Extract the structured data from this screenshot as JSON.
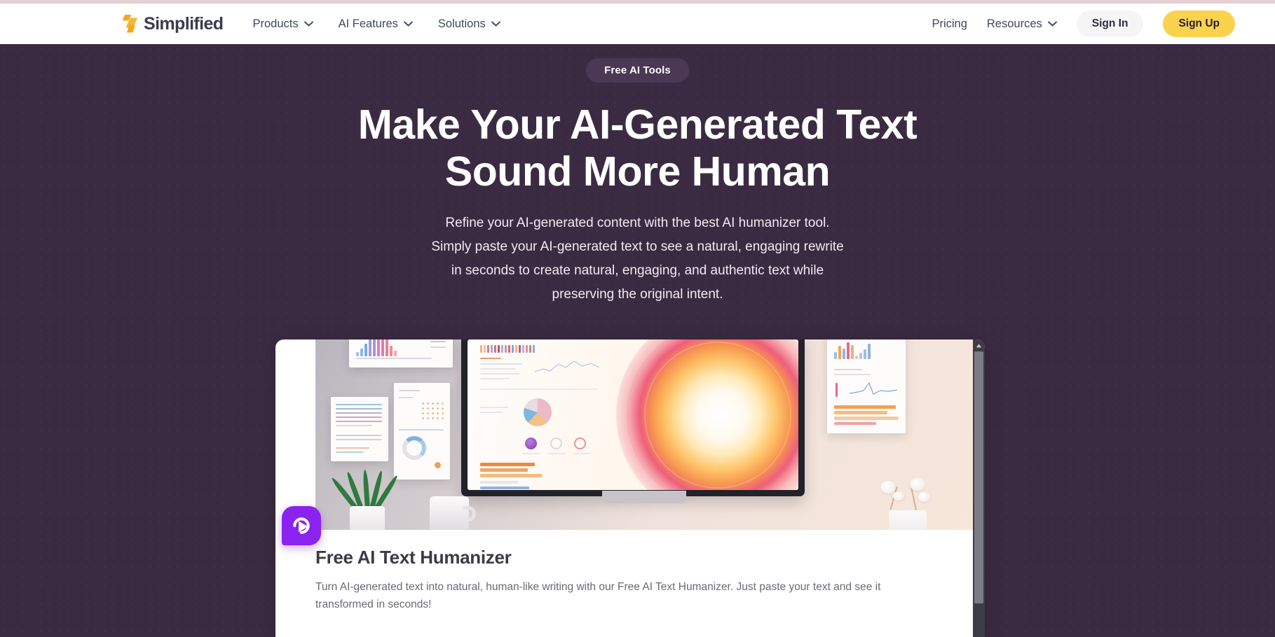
{
  "brand": {
    "name": "Simplified",
    "logo_icon": "lightning-bolt-logo-icon",
    "logo_color": "#f5a623"
  },
  "header": {
    "nav_left": [
      {
        "label": "Products",
        "icon": "chevron-down-icon",
        "has_dropdown": true
      },
      {
        "label": "AI Features",
        "icon": "chevron-down-icon",
        "has_dropdown": true
      },
      {
        "label": "Solutions",
        "icon": "chevron-down-icon",
        "has_dropdown": true
      }
    ],
    "nav_right": [
      {
        "label": "Pricing",
        "has_dropdown": false
      },
      {
        "label": "Resources",
        "icon": "chevron-down-icon",
        "has_dropdown": true
      }
    ],
    "sign_in_label": "Sign In",
    "sign_up_label": "Sign Up",
    "sign_up_color": "#fbd24e",
    "sign_in_color": "#f5f5f7"
  },
  "hero": {
    "badge": "Free AI Tools",
    "title_line1": "Make Your AI-Generated Text",
    "title_line2": "Sound More Human",
    "subtitle_line1": "Refine your AI-generated content with the best AI humanizer tool.",
    "subtitle_line2": "Simply paste your AI-generated text to see a natural, engaging rewrite",
    "subtitle_line3": "in seconds to create natural, engaging, and authentic text while",
    "subtitle_line4": "preserving the original intent.",
    "background_color": "#3b2b42",
    "accent_purple": "#8c22f0"
  },
  "video_card": {
    "play_icon": "play-button-icon",
    "title": "Free AI Text Humanizer",
    "description": "Turn AI-generated text into natural, human-like writing with our Free AI Text Humanizer. Just paste your text and see it transformed in seconds!",
    "thumbnail_alt": "Desk scene with a monitor showing a glowing circular data visualization, printed analytics sheets on the wall, a plant, a mug and a vase of white flowers"
  },
  "scrollbar": {
    "up_arrow_icon": "scroll-up-arrow-icon",
    "thumb_name": "scroll-thumb"
  }
}
